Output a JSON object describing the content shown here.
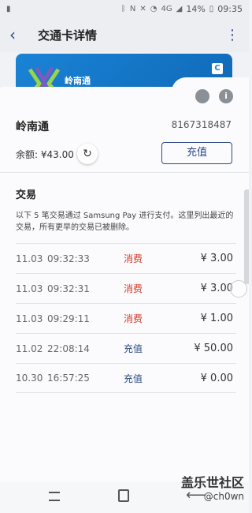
{
  "status": {
    "battery": "14%",
    "time": "09:35",
    "network": "4G"
  },
  "header": {
    "title": "交通卡详情"
  },
  "card": {
    "brand_name": "岭南通",
    "number": "8167318487",
    "balance_label": "余额: ¥43.00"
  },
  "actions": {
    "topup_label": "充值"
  },
  "transactions": {
    "title": "交易",
    "description": "以下 5 笔交易通过 Samsung Pay 进行支付。这里列出最近的交易，所有更早的交易已被删除。",
    "rows": [
      {
        "date": "11.03",
        "time": "09:32:33",
        "type": "消费",
        "amount": "¥ 3.00"
      },
      {
        "date": "11.03",
        "time": "09:32:31",
        "type": "消费",
        "amount": "¥ 3.00"
      },
      {
        "date": "11.03",
        "time": "09:29:11",
        "type": "消费",
        "amount": "¥ 1.00"
      },
      {
        "date": "11.02",
        "time": "22:08:14",
        "type": "充值",
        "amount": "¥ 50.00"
      },
      {
        "date": "10.30",
        "time": "16:57:25",
        "type": "充值",
        "amount": "¥ 0.00"
      }
    ]
  },
  "watermark": {
    "site": "盖乐世社区",
    "user": "@ch0wn"
  },
  "colors": {
    "accent": "#2b4b85",
    "spend": "#d23a2a",
    "card": "#1a83d6"
  }
}
